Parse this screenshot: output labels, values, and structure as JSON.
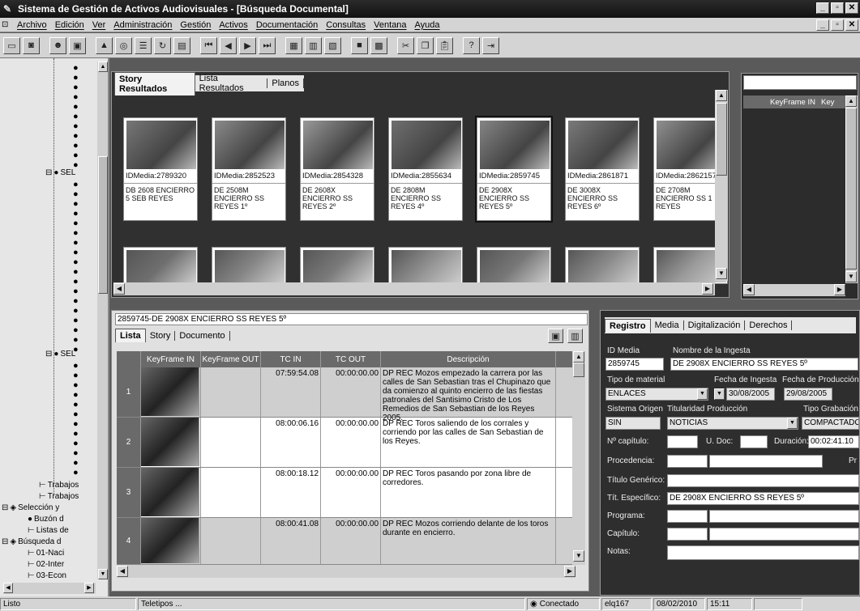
{
  "window": {
    "title": "Sistema de Gestión de Activos Audiovisuales - [Búsqueda Documental]",
    "buttons": [
      "_",
      "▫",
      "✕"
    ]
  },
  "menu": [
    "Archivo",
    "Edición",
    "Ver",
    "Administración",
    "Gestión",
    "Activos",
    "Documentación",
    "Consultas",
    "Ventana",
    "Ayuda"
  ],
  "sidebar": {
    "nodes": [
      {
        "label": "SEL"
      },
      {
        "label": "SEL"
      },
      {
        "label": "Trabajos"
      },
      {
        "label": "Trabajos"
      },
      {
        "label": "Selección y"
      },
      {
        "label": "Buzón d"
      },
      {
        "label": "Listas de"
      },
      {
        "label": "Búsqueda d"
      },
      {
        "label": "01-Naci"
      },
      {
        "label": "02-Inter"
      },
      {
        "label": "03-Econ"
      }
    ]
  },
  "story_panel": {
    "tabs": [
      "Story Resultados",
      "Lista Resultados",
      "Planos"
    ],
    "cards": [
      {
        "id": "IDMedia:2789320",
        "desc": "DB 2608 ENCIERRO 5 SEB REYES"
      },
      {
        "id": "IDMedia:2852523",
        "desc": "DE 2508M ENCIERRO SS REYES 1º"
      },
      {
        "id": "IDMedia:2854328",
        "desc": "DE 2608X ENCIERRO SS REYES 2º"
      },
      {
        "id": "IDMedia:2855634",
        "desc": "DE 2808M ENCIERRO SS REYES 4º"
      },
      {
        "id": "IDMedia:2859745",
        "desc": "DE 2908X ENCIERRO SS REYES 5º"
      },
      {
        "id": "IDMedia:2861871",
        "desc": "DE 3008X ENCIERRO SS REYES 6º"
      },
      {
        "id": "IDMedia:2862157",
        "desc": "DE 2708M ENCIERRO SS 1 REYES"
      }
    ]
  },
  "keyframe_panel": {
    "columns": [
      "KeyFrame IN",
      "Key"
    ]
  },
  "doc_panel": {
    "title": "2859745-DE 2908X ENCIERRO SS REYES 5º",
    "tabs": [
      "Lista",
      "Story",
      "Documento"
    ],
    "columns": [
      "KeyFrame IN",
      "KeyFrame OUT",
      "TC IN",
      "TC OUT",
      "Descripción"
    ],
    "rows": [
      {
        "n": "1",
        "tcin": "07:59:54.08",
        "tcout": "00:00:00.00",
        "desc": "DP REC Mozos empezado la carrera por las calles de San Sebastian tras el Chupinazo que da comienzo al quinto encierro de las fiestas patronales del Santisimo Cristo de Los Remedios de San Sebastian de los Reyes 2005."
      },
      {
        "n": "2",
        "tcin": "08:00:06.16",
        "tcout": "00:00:00.00",
        "desc": "DP REC Toros saliendo de los corrales y corriendo por las calles de San Sebastian de los Reyes."
      },
      {
        "n": "3",
        "tcin": "08:00:18.12",
        "tcout": "00:00:00.00",
        "desc": "DP REC Toros pasando por zona libre de corredores."
      },
      {
        "n": "4",
        "tcin": "08:00:41.08",
        "tcout": "00:00:00.00",
        "desc": "DP REC Mozos corriendo delante de los toros durante en encierro."
      }
    ]
  },
  "reg_panel": {
    "tabs": [
      "Registro",
      "Media",
      "Digitalización",
      "Derechos"
    ],
    "id_media_label": "ID Media",
    "id_media": "2859745",
    "nombre_label": "Nombre de la Ingesta",
    "nombre": "DE 2908X ENCIERRO SS REYES 5º",
    "tipo_material_label": "Tipo de material",
    "tipo_material": "ENLACES",
    "fecha_ingesta_label": "Fecha de Ingesta",
    "fecha_ingesta": "30/08/2005",
    "fecha_produccion_label": "Fecha de Producción",
    "fecha_produccion": "29/08/2005",
    "sistema_origen_label": "Sistema Origen",
    "sistema_origen": "SIN",
    "titularidad_label": "Titularidad Producción",
    "titularidad": "NOTICIAS",
    "tipo_grabacion_label": "Tipo Grabación",
    "tipo_grabacion": "COMPACTADO",
    "capitulo_num_label": "Nº capítulo:",
    "udoc_label": "U. Doc:",
    "duracion_label": "Duración:",
    "duracion": "00:02:41.10",
    "procedencia_label": "Procedencia:",
    "pr_label": "Pr",
    "titulo_generico_label": "Título Genérico:",
    "tit_especifico_label": "Tít. Específico:",
    "tit_especifico": "DE 2908X ENCIERRO SS REYES 5º",
    "programa_label": "Programa:",
    "capitulo_label": "Capítulo:",
    "notas_label": "Notas:"
  },
  "status": {
    "ready": "Listo",
    "teletipos": "Teletipos ...",
    "conn": "Conectado",
    "user": "elq167",
    "date": "08/02/2010",
    "time": "15:11"
  }
}
